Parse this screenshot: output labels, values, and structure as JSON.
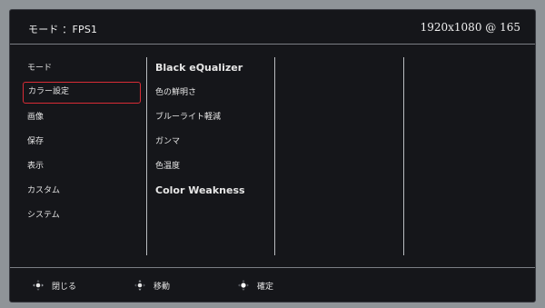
{
  "header": {
    "mode_text": "モード ：FPS1",
    "resolution_text": "1920x1080 @ 165"
  },
  "left_menu": {
    "items": [
      {
        "label": "モード",
        "selected": false
      },
      {
        "label": "カラー設定",
        "selected": true
      },
      {
        "label": "画像",
        "selected": false
      },
      {
        "label": "保存",
        "selected": false
      },
      {
        "label": "表示",
        "selected": false
      },
      {
        "label": "カスタム",
        "selected": false
      },
      {
        "label": "システム",
        "selected": false
      }
    ]
  },
  "sub_menu": {
    "items": [
      {
        "label": "Black eQualizer"
      },
      {
        "label": "色の鮮明さ"
      },
      {
        "label": "ブルーライト軽減"
      },
      {
        "label": "ガンマ"
      },
      {
        "label": "色温度"
      },
      {
        "label": "Color Weakness"
      }
    ]
  },
  "footer": {
    "close_label": "閉じる",
    "move_label": "移動",
    "confirm_label": "確定",
    "icons": [
      "dpad-left-right-icon",
      "dpad-up-down-icon",
      "dpad-press-icon"
    ]
  },
  "colors": {
    "background": "#15161a",
    "selection_border": "#d82c36",
    "divider": "#b9bcc0"
  }
}
